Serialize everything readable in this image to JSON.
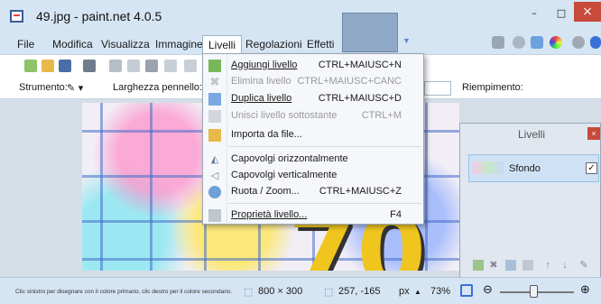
{
  "window": {
    "title": "49.jpg - paint.net 4.0.5",
    "close_glyph": "×",
    "minimize_glyph": "–",
    "maximize_glyph": "□"
  },
  "menubar": {
    "items": [
      {
        "label": "File"
      },
      {
        "label": "Modifica"
      },
      {
        "label": "Visualizza"
      },
      {
        "label": "Immagine"
      },
      {
        "label": "Livelli"
      },
      {
        "label": "Regolazioni"
      },
      {
        "label": "Effetti"
      }
    ],
    "active": "Livelli"
  },
  "toolbar2": {
    "tool_label": "Strumento:",
    "brush_width_label": "Larghezza pennello:",
    "fill_label": "Riempimento:"
  },
  "layers_menu": {
    "items": [
      {
        "label": "Aggiungi livello",
        "shortcut": "CTRL+MAIUSC+N",
        "icon": "add-layer-icon",
        "enabled": true
      },
      {
        "label": "Elimina livello",
        "shortcut": "CTRL+MAIUSC+CANC",
        "icon": "delete-layer-icon",
        "enabled": false
      },
      {
        "label": "Duplica livello",
        "shortcut": "CTRL+MAIUSC+D",
        "icon": "duplicate-layer-icon",
        "enabled": true
      },
      {
        "label": "Unisci livello sottostante",
        "shortcut": "CTRL+M",
        "icon": "merge-layer-icon",
        "enabled": false
      },
      {
        "label": "Importa da file...",
        "shortcut": "",
        "icon": "import-file-icon",
        "enabled": true
      },
      {
        "label": "Capovolgi orizzontalmente",
        "shortcut": "",
        "icon": "flip-horizontal-icon",
        "enabled": true
      },
      {
        "label": "Capovolgi verticalmente",
        "shortcut": "",
        "icon": "flip-vertical-icon",
        "enabled": true
      },
      {
        "label": "Ruota / Zoom...",
        "shortcut": "CTRL+MAIUSC+Z",
        "icon": "rotate-zoom-icon",
        "enabled": true
      },
      {
        "label": "Proprietà livello...",
        "shortcut": "F4",
        "icon": "layer-properties-icon",
        "enabled": true
      }
    ]
  },
  "layers_panel": {
    "title": "Livelli",
    "close_glyph": "×",
    "layers": [
      {
        "name": "Sfondo",
        "visible": true,
        "check_glyph": "✓"
      }
    ],
    "buttons": [
      "add-layer",
      "delete-layer",
      "duplicate-layer",
      "merge-layer",
      "move-up",
      "move-down",
      "properties"
    ]
  },
  "canvas": {
    "text_partial": "70"
  },
  "statusbar": {
    "hint": "Clic sinistro per disegnare con il colore primario, clic destro per il colore secondario.",
    "image_size": "800 × 300",
    "cursor_pos": "257, -165",
    "unit": "px",
    "zoom": "73%"
  },
  "colors": {
    "accent": "#3a6fd6",
    "close_red": "#c74a3a",
    "chrome": "#d6e5f3"
  }
}
